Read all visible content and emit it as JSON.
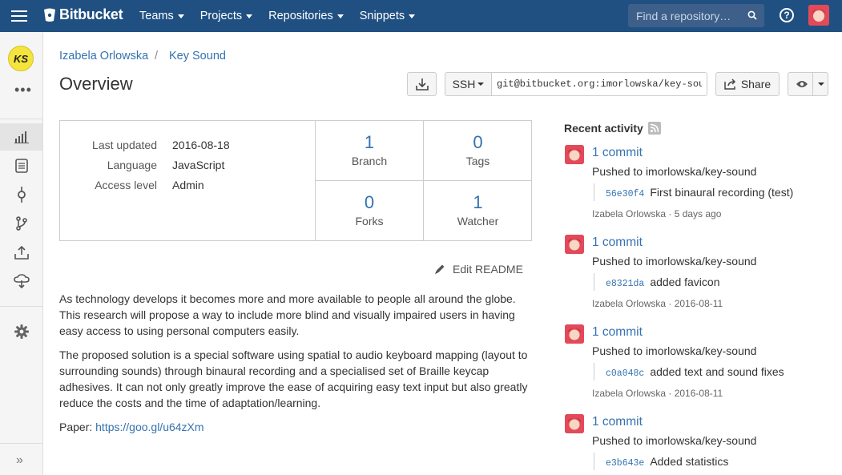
{
  "app": {
    "name": "Bitbucket"
  },
  "topnav": {
    "items": [
      "Teams",
      "Projects",
      "Repositories",
      "Snippets"
    ],
    "search_placeholder": "Find a repository…"
  },
  "sidebar": {
    "project_initials": "KS"
  },
  "breadcrumb": {
    "owner": "Izabela Orlowska",
    "separator": "/",
    "repo": "Key Sound"
  },
  "page": {
    "title": "Overview"
  },
  "clone": {
    "protocol": "SSH",
    "url": "git@bitbucket.org:imorlowska/key-sound.git"
  },
  "toolbar": {
    "share_label": "Share"
  },
  "info": {
    "rows": [
      {
        "key": "Last updated",
        "value": "2016-08-18"
      },
      {
        "key": "Language",
        "value": "JavaScript"
      },
      {
        "key": "Access level",
        "value": "Admin"
      }
    ],
    "stats": [
      {
        "count": "1",
        "label": "Branch"
      },
      {
        "count": "0",
        "label": "Tags"
      },
      {
        "count": "0",
        "label": "Forks"
      },
      {
        "count": "1",
        "label": "Watcher"
      }
    ]
  },
  "readme": {
    "edit_label": "Edit README",
    "paragraphs": [
      "As technology develops it becomes more and more available to people all around the globe. This research will propose a way to include more blind and visually impaired users in having easy access to using personal computers easily.",
      "The proposed solution is a special software using spatial to audio keyboard mapping (layout to surrounding sounds) through binaural recording and a specialised set of Braille keycap adhesives. It can not only greatly improve the ease of acquiring easy text input but also greatly reduce the costs and the time of adaptation/learning."
    ],
    "paper_label": "Paper:",
    "paper_link": "https://goo.gl/u64zXm"
  },
  "activity": {
    "title": "Recent activity",
    "items": [
      {
        "head": "1 commit",
        "pushed": "Pushed to imorlowska/key-sound",
        "hash": "56e30f4",
        "message": "First binaural recording (test)",
        "by": "Izabela Orlowska · 5 days ago"
      },
      {
        "head": "1 commit",
        "pushed": "Pushed to imorlowska/key-sound",
        "hash": "e8321da",
        "message": "added favicon",
        "by": "Izabela Orlowska · 2016-08-11"
      },
      {
        "head": "1 commit",
        "pushed": "Pushed to imorlowska/key-sound",
        "hash": "c0a048c",
        "message": "added text and sound fixes",
        "by": "Izabela Orlowska · 2016-08-11"
      },
      {
        "head": "1 commit",
        "pushed": "Pushed to imorlowska/key-sound",
        "hash": "e3b643e",
        "message": "Added statistics",
        "by": ""
      }
    ]
  },
  "colors": {
    "header": "#205081",
    "link": "#3572b0",
    "sidebar": "#f5f5f5"
  }
}
